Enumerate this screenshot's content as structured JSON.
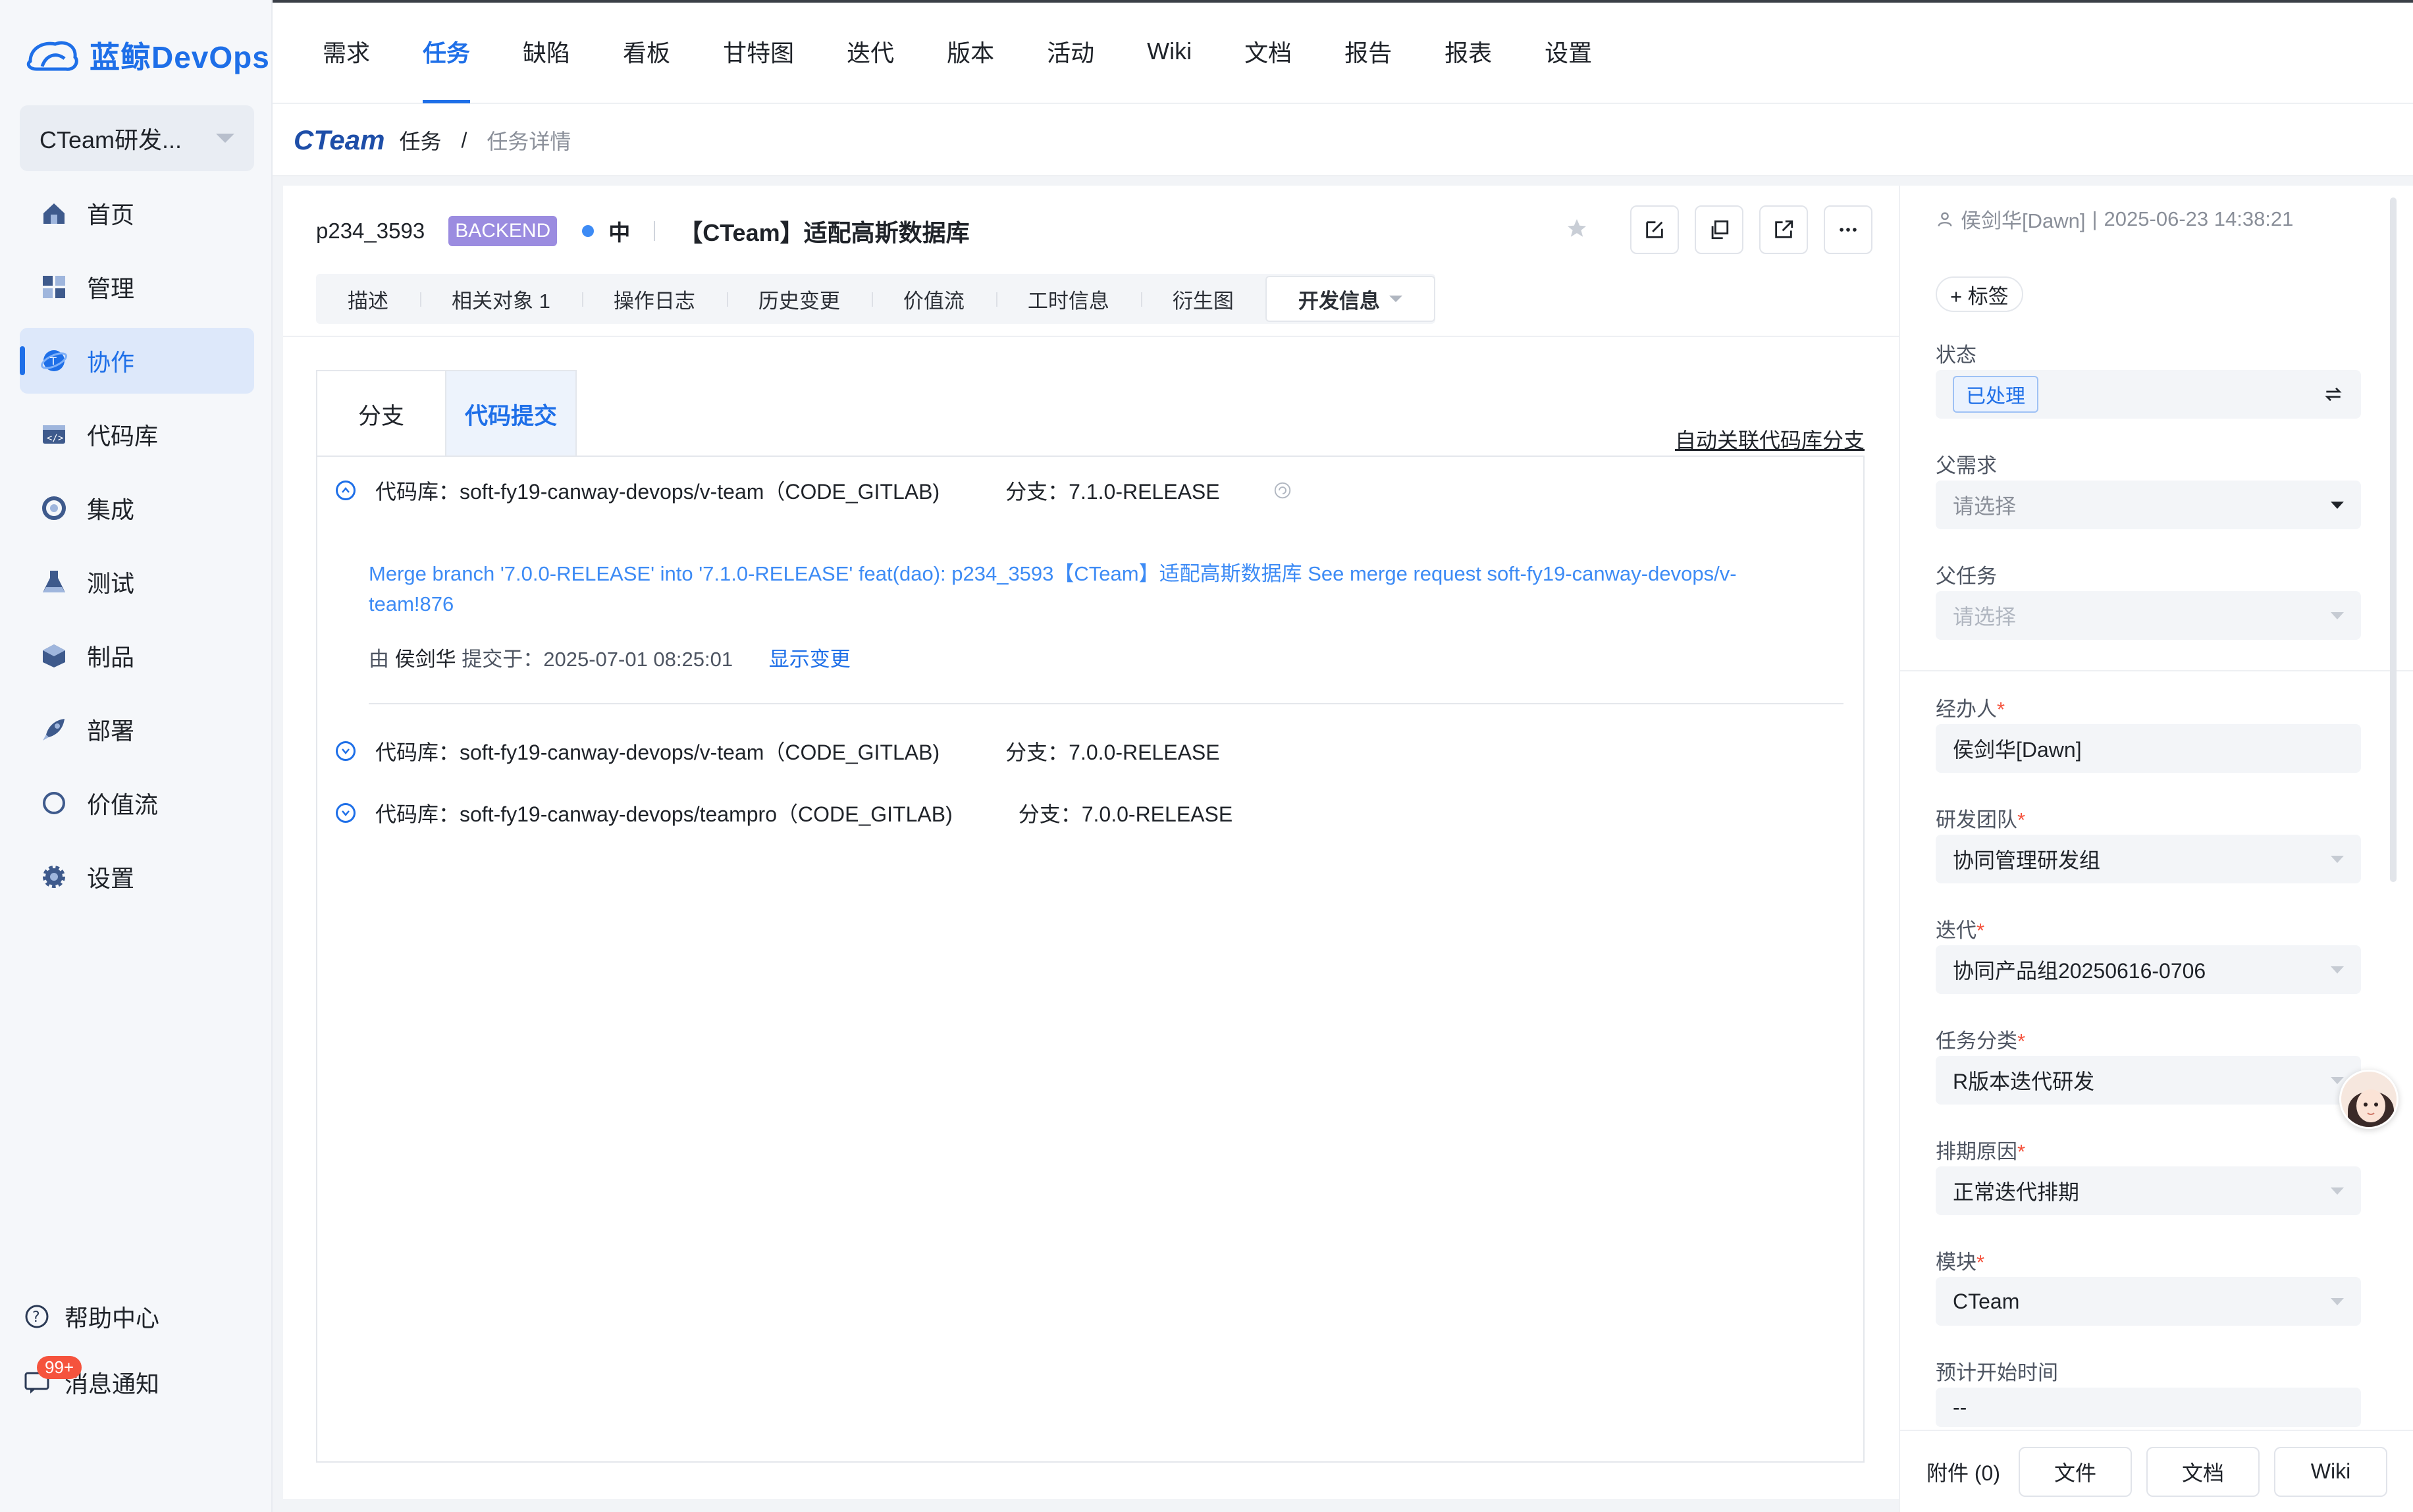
{
  "app": {
    "name": "蓝鲸DevOps"
  },
  "project": {
    "name": "CTeam研发..."
  },
  "sidebar": {
    "items": [
      {
        "label": "首页",
        "icon": "home-icon"
      },
      {
        "label": "管理",
        "icon": "manage-icon"
      },
      {
        "label": "协作",
        "icon": "collaboration-icon",
        "active": true
      },
      {
        "label": "代码库",
        "icon": "code-repo-icon"
      },
      {
        "label": "集成",
        "icon": "integration-icon"
      },
      {
        "label": "测试",
        "icon": "test-icon"
      },
      {
        "label": "制品",
        "icon": "artifact-icon"
      },
      {
        "label": "部署",
        "icon": "deploy-icon"
      },
      {
        "label": "价值流",
        "icon": "value-stream-icon"
      },
      {
        "label": "设置",
        "icon": "settings-icon"
      }
    ],
    "help": "帮助中心",
    "notice": "消息通知",
    "notice_badge": "99+"
  },
  "topnav": [
    "需求",
    "任务",
    "缺陷",
    "看板",
    "甘特图",
    "迭代",
    "版本",
    "活动",
    "Wiki",
    "文档",
    "报告",
    "报表",
    "设置"
  ],
  "breadcrumb": {
    "logo": "CTeam",
    "section": "任务",
    "sep": "/",
    "current": "任务详情"
  },
  "task": {
    "id": "p234_3593",
    "tag": "BACKEND",
    "priority": "中",
    "title": "【CTeam】适配高斯数据库"
  },
  "subtabs": [
    "描述",
    "相关对象 1",
    "操作日志",
    "历史变更",
    "价值流",
    "工时信息",
    "衍生图",
    "开发信息"
  ],
  "panel": {
    "tabs": [
      "分支",
      "代码提交"
    ],
    "auto_link": "自动关联代码库分支",
    "repos": [
      {
        "repo": "代码库：soft-fy19-canway-devops/v-team（CODE_GITLAB)",
        "branch": "分支：7.1.0-RELEASE",
        "expanded": true
      },
      {
        "repo": "代码库：soft-fy19-canway-devops/v-team（CODE_GITLAB)",
        "branch": "分支：7.0.0-RELEASE",
        "expanded": false
      },
      {
        "repo": "代码库：soft-fy19-canway-devops/teampro（CODE_GITLAB)",
        "branch": "分支：7.0.0-RELEASE",
        "expanded": false
      }
    ],
    "commit": {
      "message": "Merge branch '7.0.0-RELEASE' into '7.1.0-RELEASE' feat(dao): p234_3593【CTeam】适配高斯数据库 See merge request soft-fy19-canway-devops/v-team!876",
      "by_prefix": "由",
      "author": "侯剑华",
      "submitted": "提交于：2025-07-01 08:25:01",
      "show_changes": "显示变更"
    }
  },
  "right": {
    "creator": "侯剑华[Dawn]",
    "created_at": "2025-06-23 14:38:21",
    "tag_btn": "+ 标签",
    "status_label": "状态",
    "status_value": "已处理",
    "parent_req_label": "父需求",
    "parent_req_ph": "请选择",
    "parent_task_label": "父任务",
    "parent_task_ph": "请选择",
    "assignee_label": "经办人",
    "assignee": "侯剑华[Dawn]",
    "team_label": "研发团队",
    "team": "协同管理研发组",
    "iteration_label": "迭代",
    "iteration": "协同产品组20250616-0706",
    "category_label": "任务分类",
    "category": "R版本迭代研发",
    "schedule_label": "排期原因",
    "schedule": "正常迭代排期",
    "module_label": "模块",
    "module": "CTeam",
    "start_label": "预计开始时间",
    "start": "--",
    "attachments": "附件 (0)",
    "btn_file": "文件",
    "btn_doc": "文档",
    "btn_wiki": "Wiki"
  },
  "colors": {
    "accent": "#1e6fe8",
    "backend_tag": "#9b8ce0",
    "danger": "#f5533d",
    "link": "#3d8bf5"
  }
}
